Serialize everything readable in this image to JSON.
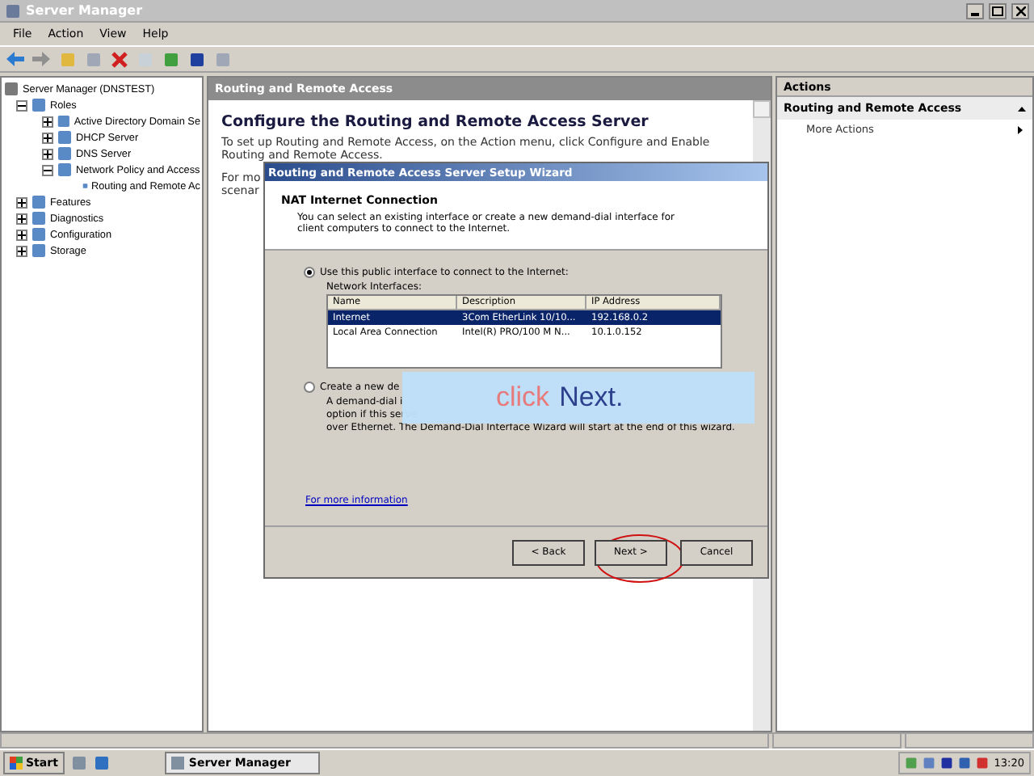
{
  "window": {
    "title": "Server Manager"
  },
  "menu": [
    "File",
    "Action",
    "View",
    "Help"
  ],
  "tree": [
    {
      "label": "Server Manager (DNSTEST)",
      "children": [
        {
          "label": "Roles",
          "expanded": true,
          "children": [
            {
              "label": "Active Directory Domain Se",
              "expanded": false
            },
            {
              "label": "DHCP Server",
              "expanded": false
            },
            {
              "label": "DNS Server",
              "expanded": false
            },
            {
              "label": "Network Policy and Access",
              "expanded": true,
              "children": [
                {
                  "label": "Routing and Remote Ac"
                }
              ]
            }
          ]
        },
        {
          "label": "Features",
          "expanded": false
        },
        {
          "label": "Diagnostics",
          "expanded": false
        },
        {
          "label": "Configuration",
          "expanded": false
        },
        {
          "label": "Storage",
          "expanded": false
        }
      ]
    }
  ],
  "content": {
    "header": "Routing and Remote Access",
    "title": "Configure the Routing and Remote Access Server",
    "paragraph": "To set up Routing and Remote Access, on the Action menu, click Configure and Enable Routing and Remote Access.",
    "more_lines": [
      "For mo",
      "scenar"
    ]
  },
  "actions": {
    "header": "Actions",
    "section": "Routing and Remote Access",
    "items": [
      "More Actions"
    ]
  },
  "wizard": {
    "title": "Routing and Remote Access Server Setup Wizard",
    "heading": "NAT Internet Connection",
    "description": "You can select an existing interface or create a new demand-dial interface for client computers to connect to the Internet.",
    "options": [
      {
        "label": "Use this public interface to connect to the Internet:",
        "selected": true
      },
      {
        "label": "Create a new de",
        "selected": false
      }
    ],
    "list_label": "Network Interfaces:",
    "columns": [
      "Name",
      "Description",
      "IP Address"
    ],
    "rows": [
      {
        "cells": [
          "Internet",
          "3Com EtherLink 10/10...",
          "192.168.0.2"
        ],
        "selected": true
      },
      {
        "cells": [
          "Local Area Connection",
          "Intel(R) PRO/100 M N...",
          "10.1.0.152"
        ],
        "selected": false
      }
    ],
    "option_text": [
      "A demand-dial i",
      "option if this serve",
      "over Ethernet. The Demand-Dial Interface Wizard will start at the end of this wizard."
    ],
    "link": "For more information",
    "buttons": [
      "< Back",
      "Next >",
      "Cancel"
    ]
  },
  "callout": {
    "word": "click",
    "target": "Next."
  },
  "taskbar": {
    "start": "Start",
    "task": "Server Manager",
    "time": "13:20"
  }
}
